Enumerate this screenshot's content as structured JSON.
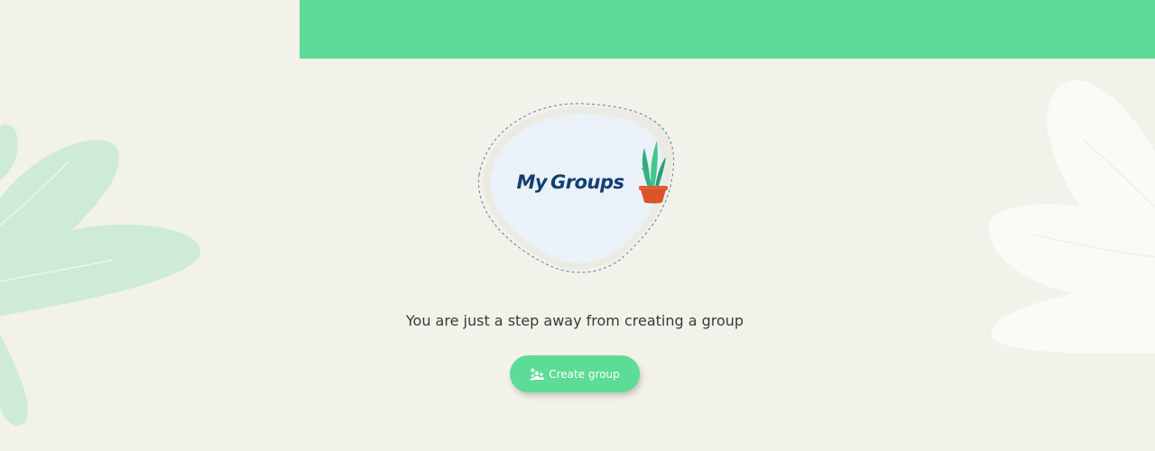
{
  "banner": {
    "color": "#5cdc96"
  },
  "illustration": {
    "logo_word1": "My",
    "logo_word2": "Groups",
    "logo_color": "#123e72",
    "icon": "potted-plant"
  },
  "empty_state": {
    "message": "You are just a step away from creating a group"
  },
  "create_button": {
    "label": "Create group",
    "icon": "add-group-icon",
    "color": "#5cdc96"
  },
  "decorations": {
    "left_leaf_color": "#cdebd8",
    "right_leaf_color": "#fafaf6"
  }
}
